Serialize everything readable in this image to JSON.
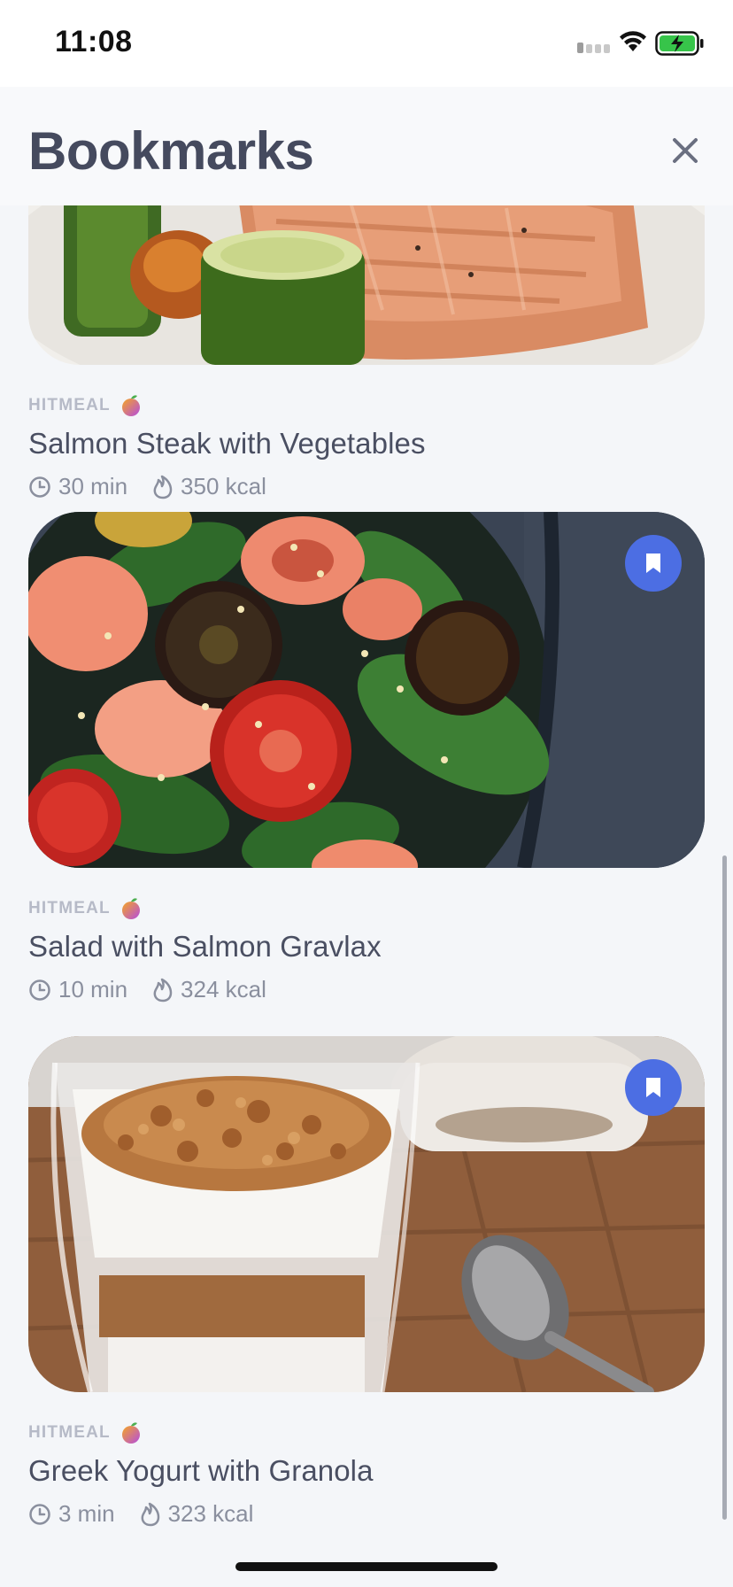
{
  "status_bar": {
    "time": "11:08"
  },
  "header": {
    "title": "Bookmarks"
  },
  "icons": {
    "close": "close-icon",
    "bookmark": "bookmark-filled-icon",
    "clock": "clock-icon",
    "calories": "flame-icon",
    "brand_logo": "hitmeal-fruit-logo"
  },
  "colors": {
    "accent": "#4c6ee3",
    "title_text": "#454a5e",
    "meta_text": "#8a8f9e",
    "brand_text": "#b6bac7"
  },
  "recipes": [
    {
      "brand": "HITMEAL",
      "title": "Salmon Steak with Vegetables",
      "time": "30 min",
      "calories": "350 kcal",
      "bookmarked": true
    },
    {
      "brand": "HITMEAL",
      "title": "Salad with Salmon Gravlax",
      "time": "10 min",
      "calories": "324 kcal",
      "bookmarked": true
    },
    {
      "brand": "HITMEAL",
      "title": "Greek Yogurt with Granola",
      "time": "3 min",
      "calories": "323 kcal",
      "bookmarked": true
    }
  ]
}
